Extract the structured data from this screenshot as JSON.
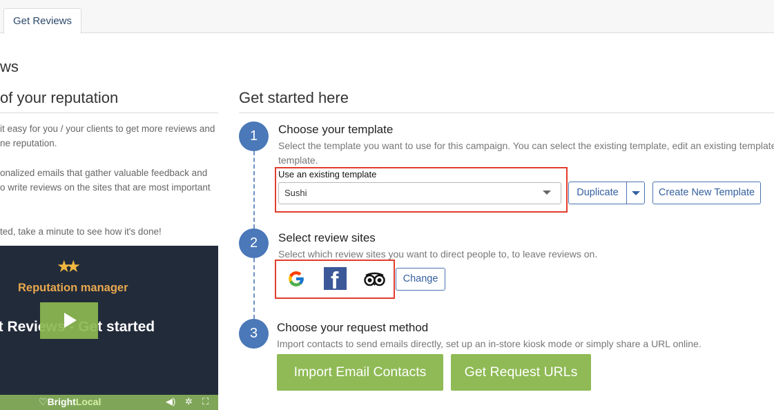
{
  "tabs": [
    {
      "label": "Get Reviews"
    }
  ],
  "page": {
    "title": "ws"
  },
  "left": {
    "heading": "of your reputation",
    "paragraphs": [
      "it easy for you / your clients to get more reviews and",
      "ne reputation.",
      "onalized emails that gather valuable feedback and",
      "o write reviews on the sites that are most important",
      "ted, take a minute to see how it's done!"
    ],
    "video": {
      "brand": "Reputation manager",
      "title": "et Reviews - Get started",
      "logo_main": "Bright",
      "logo_accent": "Local",
      "controls": [
        "volume-icon",
        "settings-icon",
        "fullscreen-icon"
      ]
    }
  },
  "right": {
    "heading": "Get started here",
    "steps": [
      {
        "number": "1",
        "title": "Choose your template",
        "description_line1": "Select the template you want to use for this campaign. You can select the existing template, edit an existing template or",
        "description_line2": "template.",
        "field_label": "Use an existing template",
        "selected_template": "Sushi",
        "duplicate_label": "Duplicate",
        "create_label": "Create New Template"
      },
      {
        "number": "2",
        "title": "Select review sites",
        "description": "Select which review sites you want to direct people to, to leave reviews on.",
        "sites": [
          "google-icon",
          "facebook-icon",
          "tripadvisor-icon"
        ],
        "change_label": "Change"
      },
      {
        "number": "3",
        "title": "Choose your request method",
        "description": "Import contacts to send emails directly, set up an in-store kiosk mode or simply share a URL online.",
        "import_label": "Import Email Contacts",
        "urls_label": "Get Request URLs"
      }
    ]
  },
  "colors": {
    "accent_blue": "#4a78b8",
    "green": "#8fba55",
    "highlight_red": "#e23c2c"
  }
}
